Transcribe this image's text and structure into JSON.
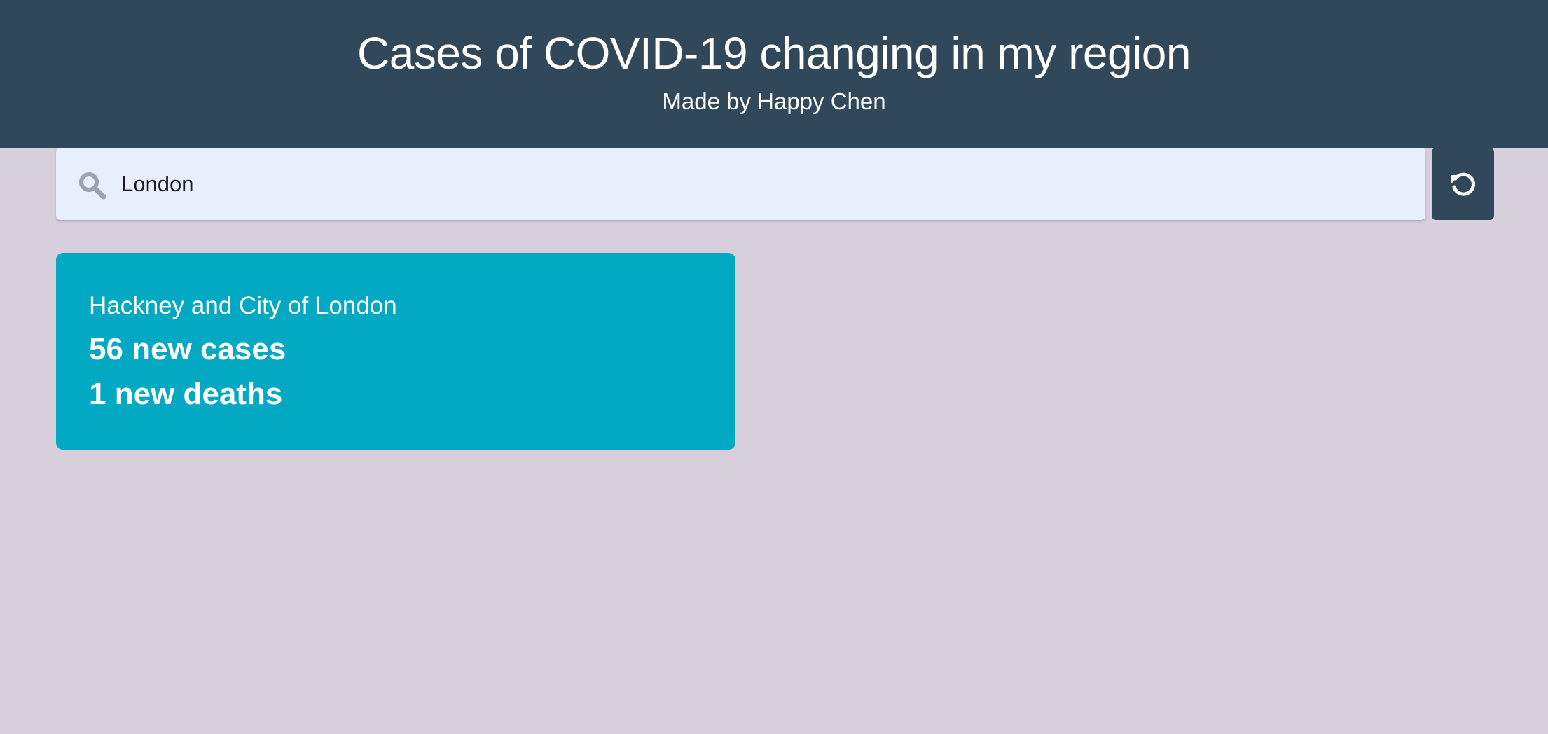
{
  "header": {
    "title": "Cases of COVID-19 changing in my region",
    "subtitle": "Made by Happy Chen"
  },
  "search": {
    "value": "London",
    "icon": "search-icon"
  },
  "reset_button": {
    "icon": "reset-icon"
  },
  "results": [
    {
      "region": "Hackney and City of London",
      "cases": "56 new cases",
      "deaths": "1 new deaths"
    }
  ],
  "colors": {
    "header_bg": "#304859",
    "page_bg": "#d8cfdd",
    "search_bg": "#e8effc",
    "card_bg": "#03a8c2",
    "text_light": "#ffffff"
  }
}
